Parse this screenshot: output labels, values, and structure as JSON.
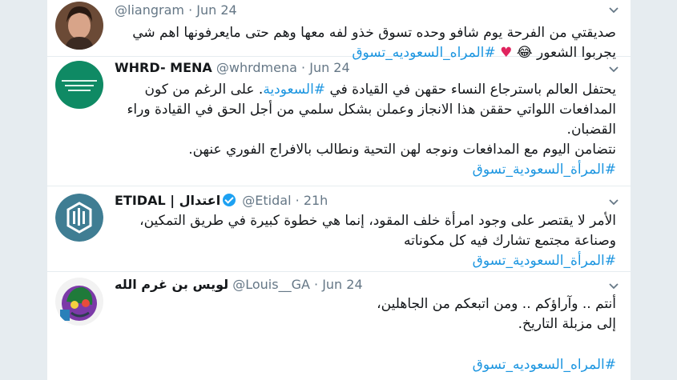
{
  "tweets": [
    {
      "name": "",
      "handle": "@liangram",
      "time": "Jun 24",
      "lines": [
        "صديقتي من الفرحة يوم شافو وحده تسوق خذو لفه معها وهم حتى مايعرفونها اهم شي",
        "يجربوا الشعور"
      ],
      "emoji": "😂",
      "heart": "♥",
      "hashtag": "#المراه_السعوديه_تسوق"
    },
    {
      "name": "WHRD- MENA",
      "handle": "@whrdmena",
      "time": "Jun 24",
      "line1_pre": "يحتفل العالم باسترجاع النساء حقهن في القيادة في ",
      "line1_tag": "#السعودية",
      "line1_post": ". على الرغم من كون",
      "line2": "المدافعات اللواتي حققن هذا الانجاز وعملن بشكل سلمي من أجل الحق في القيادة وراء",
      "line3": "القضبان.",
      "line4": "نتضامن اليوم مع المدافعات ونوجه لهن التحية ونطالب بالافراج الفوري عنهن.",
      "hashtag": "#المرأة_السعودية_تسوق"
    },
    {
      "name": "ETIDAL | اعتدال",
      "handle": "@Etidal",
      "time": "21h",
      "line1": "الأمر لا يقتصر على وجود امرأة خلف المقود، إنما هي خطوة كبيرة في طريق التمكين،",
      "line2": "وصناعة مجتمع تشارك فيه كل مكوناته",
      "hashtag": "#المرأة_السعودية_تسوق"
    },
    {
      "name": "لويس بن غرم الله",
      "handle": "@Louis__GA",
      "time": "Jun 24",
      "line1": "أنتم .. وآراؤكم .. ومن اتبعكم من الجاهلين،",
      "line2": "إلى مزبلة التاريخ.",
      "hashtag": "#المراه_السعوديه_تسوق"
    }
  ],
  "dot": "·",
  "colors": {
    "link": "#1b95e0",
    "secondary": "#657786",
    "verified": "#1da1f2",
    "heart": "#e0245e"
  },
  "icons": {
    "caret": "chevron-down-icon",
    "verified": "verified-badge-icon"
  }
}
